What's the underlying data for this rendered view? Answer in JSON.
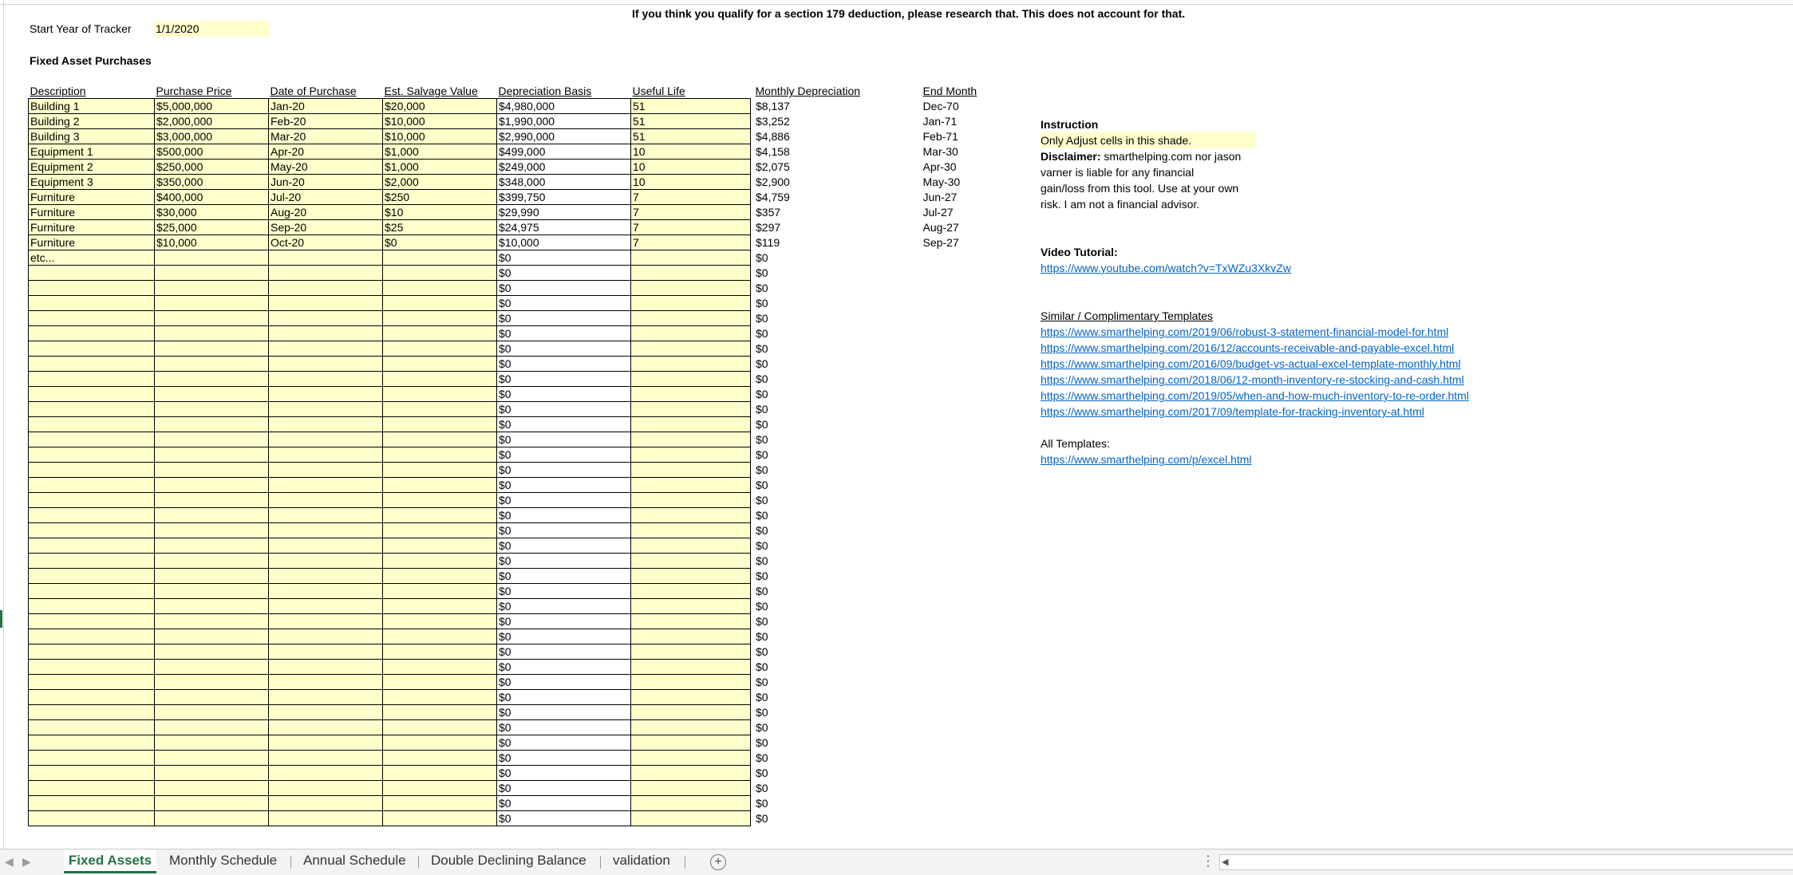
{
  "notice": "If you think you qualify for a section 179 deduction, please research that. This does not account for that.",
  "start_year": {
    "label": "Start Year of Tracker",
    "value": "1/1/2020"
  },
  "section_title": "Fixed Asset Purchases",
  "columns": [
    "Description",
    "Purchase Price",
    "Date of Purchase",
    "Est. Salvage Value",
    "Depreciation Basis",
    "Useful Life",
    "Monthly Depreciation",
    "End Month"
  ],
  "rows": [
    [
      "Building 1",
      "$5,000,000",
      "Jan-20",
      "$20,000",
      "$4,980,000",
      "51",
      "$8,137",
      "Dec-70"
    ],
    [
      "Building 2",
      "$2,000,000",
      "Feb-20",
      "$10,000",
      "$1,990,000",
      "51",
      "$3,252",
      "Jan-71"
    ],
    [
      "Building 3",
      "$3,000,000",
      "Mar-20",
      "$10,000",
      "$2,990,000",
      "51",
      "$4,886",
      "Feb-71"
    ],
    [
      "Equipment 1",
      "$500,000",
      "Apr-20",
      "$1,000",
      "$499,000",
      "10",
      "$4,158",
      "Mar-30"
    ],
    [
      "Equipment 2",
      "$250,000",
      "May-20",
      "$1,000",
      "$249,000",
      "10",
      "$2,075",
      "Apr-30"
    ],
    [
      "Equipment 3",
      "$350,000",
      "Jun-20",
      "$2,000",
      "$348,000",
      "10",
      "$2,900",
      "May-30"
    ],
    [
      "Furniture",
      "$400,000",
      "Jul-20",
      "$250",
      "$399,750",
      "7",
      "$4,759",
      "Jun-27"
    ],
    [
      "Furniture",
      "$30,000",
      "Aug-20",
      "$10",
      "$29,990",
      "7",
      "$357",
      "Jul-27"
    ],
    [
      "Furniture",
      "$25,000",
      "Sep-20",
      "$25",
      "$24,975",
      "7",
      "$297",
      "Aug-27"
    ],
    [
      "Furniture",
      "$10,000",
      "Oct-20",
      "$0",
      "$10,000",
      "7",
      "$119",
      "Sep-27"
    ],
    [
      "etc...",
      "",
      "",
      "",
      "$0",
      "",
      "$0",
      ""
    ],
    [
      "",
      "",
      "",
      "",
      "$0",
      "",
      "$0",
      ""
    ],
    [
      "",
      "",
      "",
      "",
      "$0",
      "",
      "$0",
      ""
    ],
    [
      "",
      "",
      "",
      "",
      "$0",
      "",
      "$0",
      ""
    ],
    [
      "",
      "",
      "",
      "",
      "$0",
      "",
      "$0",
      ""
    ],
    [
      "",
      "",
      "",
      "",
      "$0",
      "",
      "$0",
      ""
    ],
    [
      "",
      "",
      "",
      "",
      "$0",
      "",
      "$0",
      ""
    ],
    [
      "",
      "",
      "",
      "",
      "$0",
      "",
      "$0",
      ""
    ],
    [
      "",
      "",
      "",
      "",
      "$0",
      "",
      "$0",
      ""
    ],
    [
      "",
      "",
      "",
      "",
      "$0",
      "",
      "$0",
      ""
    ],
    [
      "",
      "",
      "",
      "",
      "$0",
      "",
      "$0",
      ""
    ],
    [
      "",
      "",
      "",
      "",
      "$0",
      "",
      "$0",
      ""
    ],
    [
      "",
      "",
      "",
      "",
      "$0",
      "",
      "$0",
      ""
    ],
    [
      "",
      "",
      "",
      "",
      "$0",
      "",
      "$0",
      ""
    ],
    [
      "",
      "",
      "",
      "",
      "$0",
      "",
      "$0",
      ""
    ],
    [
      "",
      "",
      "",
      "",
      "$0",
      "",
      "$0",
      ""
    ],
    [
      "",
      "",
      "",
      "",
      "$0",
      "",
      "$0",
      ""
    ],
    [
      "",
      "",
      "",
      "",
      "$0",
      "",
      "$0",
      ""
    ],
    [
      "",
      "",
      "",
      "",
      "$0",
      "",
      "$0",
      ""
    ],
    [
      "",
      "",
      "",
      "",
      "$0",
      "",
      "$0",
      ""
    ],
    [
      "",
      "",
      "",
      "",
      "$0",
      "",
      "$0",
      ""
    ],
    [
      "",
      "",
      "",
      "",
      "$0",
      "",
      "$0",
      ""
    ],
    [
      "",
      "",
      "",
      "",
      "$0",
      "",
      "$0",
      ""
    ],
    [
      "",
      "",
      "",
      "",
      "$0",
      "",
      "$0",
      ""
    ],
    [
      "",
      "",
      "",
      "",
      "$0",
      "",
      "$0",
      ""
    ],
    [
      "",
      "",
      "",
      "",
      "$0",
      "",
      "$0",
      ""
    ],
    [
      "",
      "",
      "",
      "",
      "$0",
      "",
      "$0",
      ""
    ],
    [
      "",
      "",
      "",
      "",
      "$0",
      "",
      "$0",
      ""
    ],
    [
      "",
      "",
      "",
      "",
      "$0",
      "",
      "$0",
      ""
    ],
    [
      "",
      "",
      "",
      "",
      "$0",
      "",
      "$0",
      ""
    ],
    [
      "",
      "",
      "",
      "",
      "$0",
      "",
      "$0",
      ""
    ],
    [
      "",
      "",
      "",
      "",
      "$0",
      "",
      "$0",
      ""
    ],
    [
      "",
      "",
      "",
      "",
      "$0",
      "",
      "$0",
      ""
    ],
    [
      "",
      "",
      "",
      "",
      "$0",
      "",
      "$0",
      ""
    ],
    [
      "",
      "",
      "",
      "",
      "$0",
      "",
      "$0",
      ""
    ],
    [
      "",
      "",
      "",
      "",
      "$0",
      "",
      "$0",
      ""
    ],
    [
      "",
      "",
      "",
      "",
      "$0",
      "",
      "$0",
      ""
    ],
    [
      "",
      "",
      "",
      "",
      "$0",
      "",
      "$0",
      ""
    ]
  ],
  "instruction": {
    "title": "Instruction",
    "shade_note": "Only Adjust cells in this shade.",
    "disclaimer_label": "Disclaimer:",
    "disclaimer_lines": [
      " smarthelping.com nor jason",
      "varner is liable for any financial",
      "gain/loss from this tool. Use at your own",
      "risk. I am not a financial advisor."
    ]
  },
  "video": {
    "title": "Video Tutorial:",
    "url": "https://www.youtube.com/watch?v=TxWZu3XkvZw"
  },
  "similar": {
    "title": "Similar / Complimentary Templates",
    "links": [
      "https://www.smarthelping.com/2019/06/robust-3-statement-financial-model-for.html",
      "https://www.smarthelping.com/2016/12/accounts-receivable-and-payable-excel.html",
      "https://www.smarthelping.com/2016/09/budget-vs-actual-excel-template-monthly.html",
      "https://www.smarthelping.com/2018/06/12-month-inventory-re-stocking-and-cash.html",
      "https://www.smarthelping.com/2019/05/when-and-how-much-inventory-to-re-order.html",
      "https://www.smarthelping.com/2017/09/template-for-tracking-inventory-at.html"
    ]
  },
  "all_templates": {
    "title": "All Templates:",
    "url": "https://www.smarthelping.com/p/excel.html"
  },
  "tabs": [
    "Fixed Assets",
    "Monthly Schedule",
    "Annual Schedule",
    "Double Declining Balance",
    "validation"
  ],
  "active_tab": "Fixed Assets",
  "icons": {
    "add_sheet": "plus-circle-icon",
    "prev": "chevron-left-icon",
    "next": "chevron-right-icon",
    "options": "vertical-dots-icon"
  },
  "colors": {
    "input_shade": "#ffffcc",
    "link": "#0563c1",
    "active_tab": "#217346"
  }
}
